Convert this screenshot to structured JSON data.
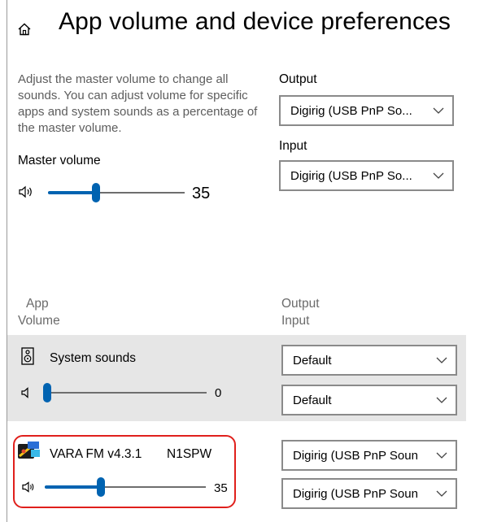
{
  "header": {
    "title": "App volume and device preferences",
    "home_icon": "home-icon"
  },
  "description": "Adjust the master volume to change all sounds. You can adjust volume for specific apps and system sounds as a percentage of the master volume.",
  "master": {
    "label": "Master volume",
    "value": "35",
    "level": 0.35
  },
  "output": {
    "label": "Output",
    "selected": "Digirig (USB PnP So..."
  },
  "input": {
    "label": "Input",
    "selected": "Digirig (USB PnP So..."
  },
  "apps_header": {
    "app": "App",
    "volume": "Volume",
    "output": "Output",
    "input": "Input"
  },
  "apps": [
    {
      "name": "System sounds",
      "icon": "speaker-box-icon",
      "value": "0",
      "level": 0.0,
      "output": "Default",
      "input": "Default"
    },
    {
      "name": "VARA FM v4.3.1",
      "callsign": "N1SPW",
      "icon": "vara-app-icon",
      "value": "35",
      "level": 0.35,
      "output": "Digirig (USB PnP Soun",
      "input": "Digirig (USB PnP Soun"
    }
  ],
  "colors": {
    "accent": "#0063b1",
    "system_row_bg": "#e6e6e6",
    "highlight_outline": "#e0201c"
  }
}
